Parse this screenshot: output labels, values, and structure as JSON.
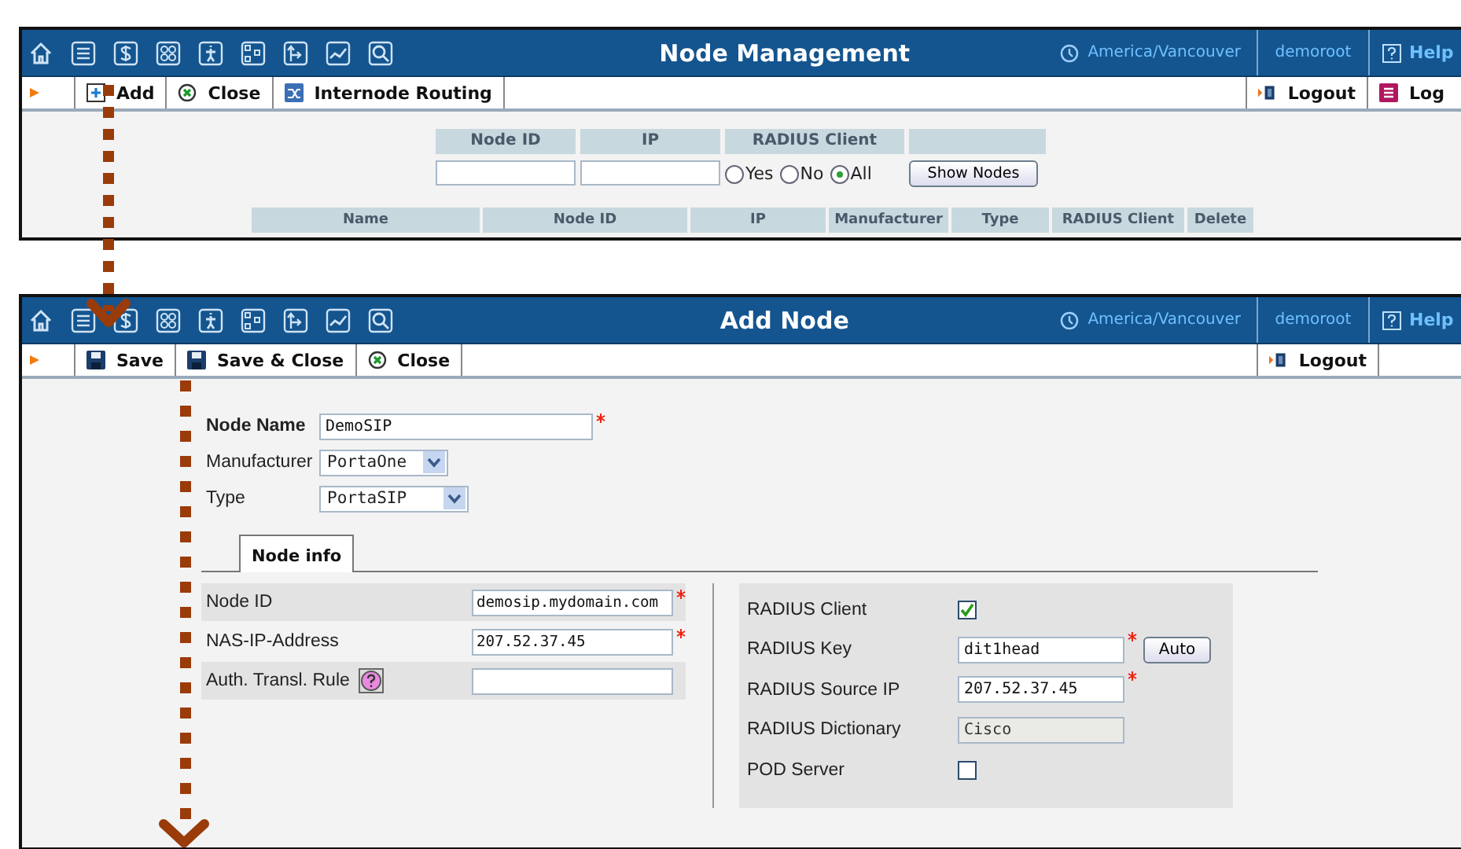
{
  "windows": [
    {
      "kind": "list",
      "title": "Node Management",
      "timezone": "America/Vancouver",
      "user": "demoroot",
      "help": "Help",
      "actions": [
        {
          "label": "Add"
        },
        {
          "label": "Close"
        },
        {
          "label": "Internode Routing"
        }
      ],
      "right_actions": [
        {
          "label": "Logout"
        },
        {
          "label": "Log"
        }
      ],
      "filter": {
        "columns": [
          "Node ID",
          "IP",
          "RADIUS Client"
        ],
        "radius_options": [
          {
            "label": "Yes",
            "selected": false
          },
          {
            "label": "No",
            "selected": false
          },
          {
            "label": "All",
            "selected": true
          }
        ],
        "button": "Show Nodes"
      },
      "table_columns": [
        "Name",
        "Node ID",
        "IP",
        "Manufacturer",
        "Type",
        "RADIUS Client",
        "Delete"
      ]
    },
    {
      "kind": "form",
      "title": "Add Node",
      "timezone": "America/Vancouver",
      "user": "demoroot",
      "help": "Help",
      "actions": [
        {
          "label": "Save"
        },
        {
          "label": "Save & Close"
        },
        {
          "label": "Close"
        }
      ],
      "right_actions": [
        {
          "label": "Logout"
        }
      ],
      "fields": [
        {
          "kind": "text",
          "label": "Node Name",
          "value": "DemoSIP",
          "required": true
        },
        {
          "kind": "select",
          "label": "Manufacturer",
          "value": "PortaOne",
          "required": false
        },
        {
          "kind": "select",
          "label": "Type",
          "value": "PortaSIP",
          "required": false
        }
      ],
      "tabs": [
        {
          "label": "Node info",
          "selected": true
        }
      ],
      "left_fields": [
        {
          "label": "Node ID",
          "value": "demosip.mydomain.com",
          "required": true,
          "help": false
        },
        {
          "label": "NAS-IP-Address",
          "value": "207.52.37.45",
          "required": true,
          "help": false
        },
        {
          "label": "Auth. Transl. Rule",
          "required": false,
          "help": true
        }
      ],
      "right_fields": [
        {
          "kind": "checkbox",
          "label": "RADIUS Client",
          "checked": true
        },
        {
          "kind": "text",
          "label": "RADIUS Key",
          "value": "dit1head",
          "required": true,
          "button": "Auto"
        },
        {
          "kind": "text",
          "label": "RADIUS Source IP",
          "value": "207.52.37.45",
          "required": true
        },
        {
          "kind": "readonly",
          "label": "RADIUS Dictionary",
          "value": "Cisco"
        },
        {
          "kind": "checkbox",
          "label": "POD Server",
          "checked": false
        }
      ]
    }
  ]
}
